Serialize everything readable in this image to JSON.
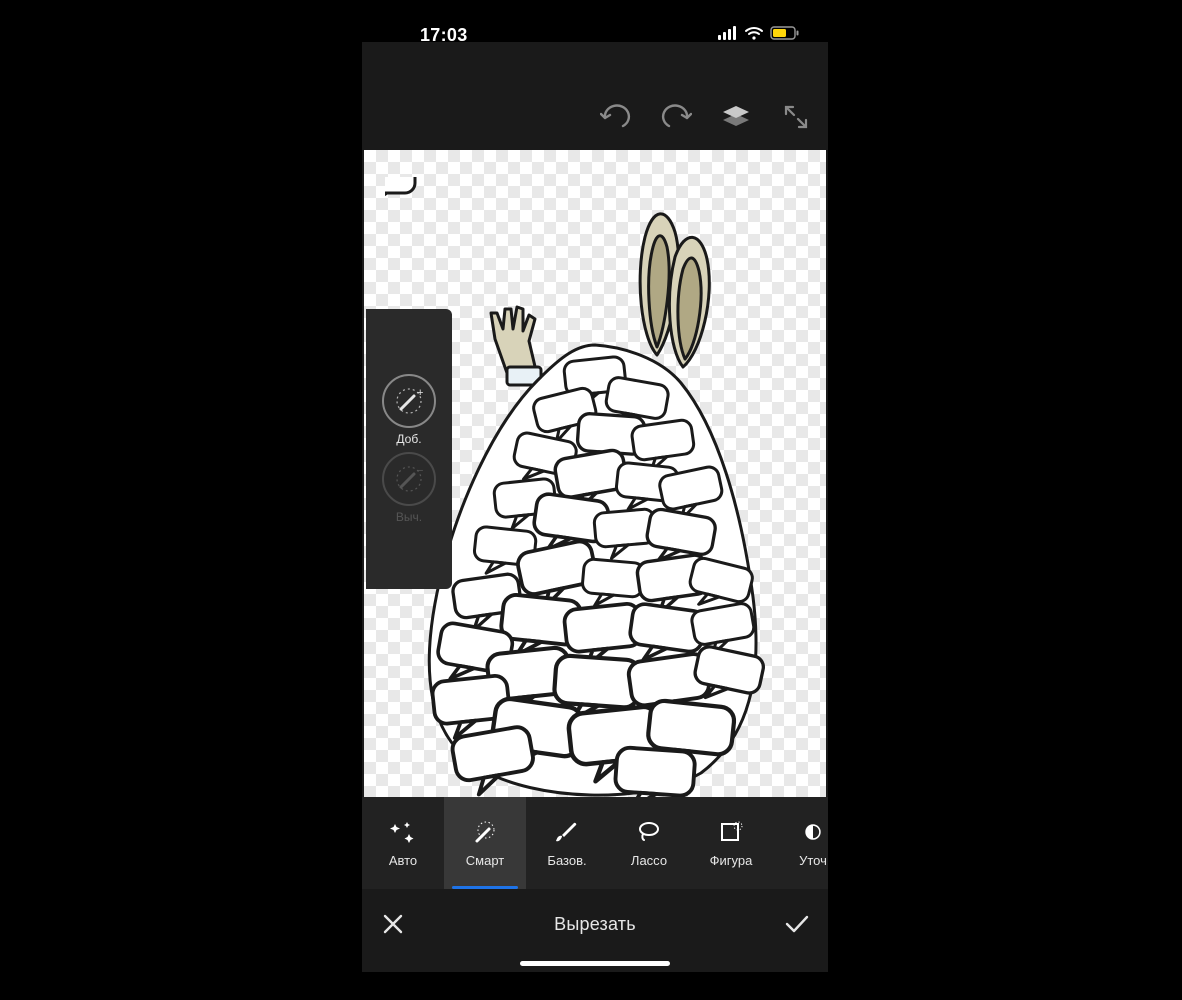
{
  "status": {
    "time": "17:03"
  },
  "top_toolbar": {
    "undo_icon": "undo-icon",
    "redo_icon": "redo-icon",
    "layers_icon": "layers-icon",
    "fullscreen_icon": "fullscreen-icon"
  },
  "side_panel": {
    "add_label": "Доб.",
    "sub_label": "Выч."
  },
  "modes": [
    {
      "id": "auto",
      "label": "Авто",
      "icon": "sparkles-icon",
      "active": false
    },
    {
      "id": "smart",
      "label": "Смарт",
      "icon": "magic-wand-icon",
      "active": true
    },
    {
      "id": "basic",
      "label": "Базов.",
      "icon": "brush-icon",
      "active": false
    },
    {
      "id": "lasso",
      "label": "Лассо",
      "icon": "lasso-icon",
      "active": false
    },
    {
      "id": "shape",
      "label": "Фигура",
      "icon": "shape-select-icon",
      "active": false
    },
    {
      "id": "refine",
      "label": "Уточ",
      "icon": "refine-edge-icon",
      "active": false
    }
  ],
  "actions": {
    "cancel_icon": "close-icon",
    "title": "Вырезать",
    "confirm_icon": "check-icon"
  },
  "canvas_content": {
    "description": "Line-art illustration of a white rabbit submerged under a triangular pile of blank speech bubbles; only its ears and one raised gloved hand stick out.",
    "background": "transparent"
  }
}
